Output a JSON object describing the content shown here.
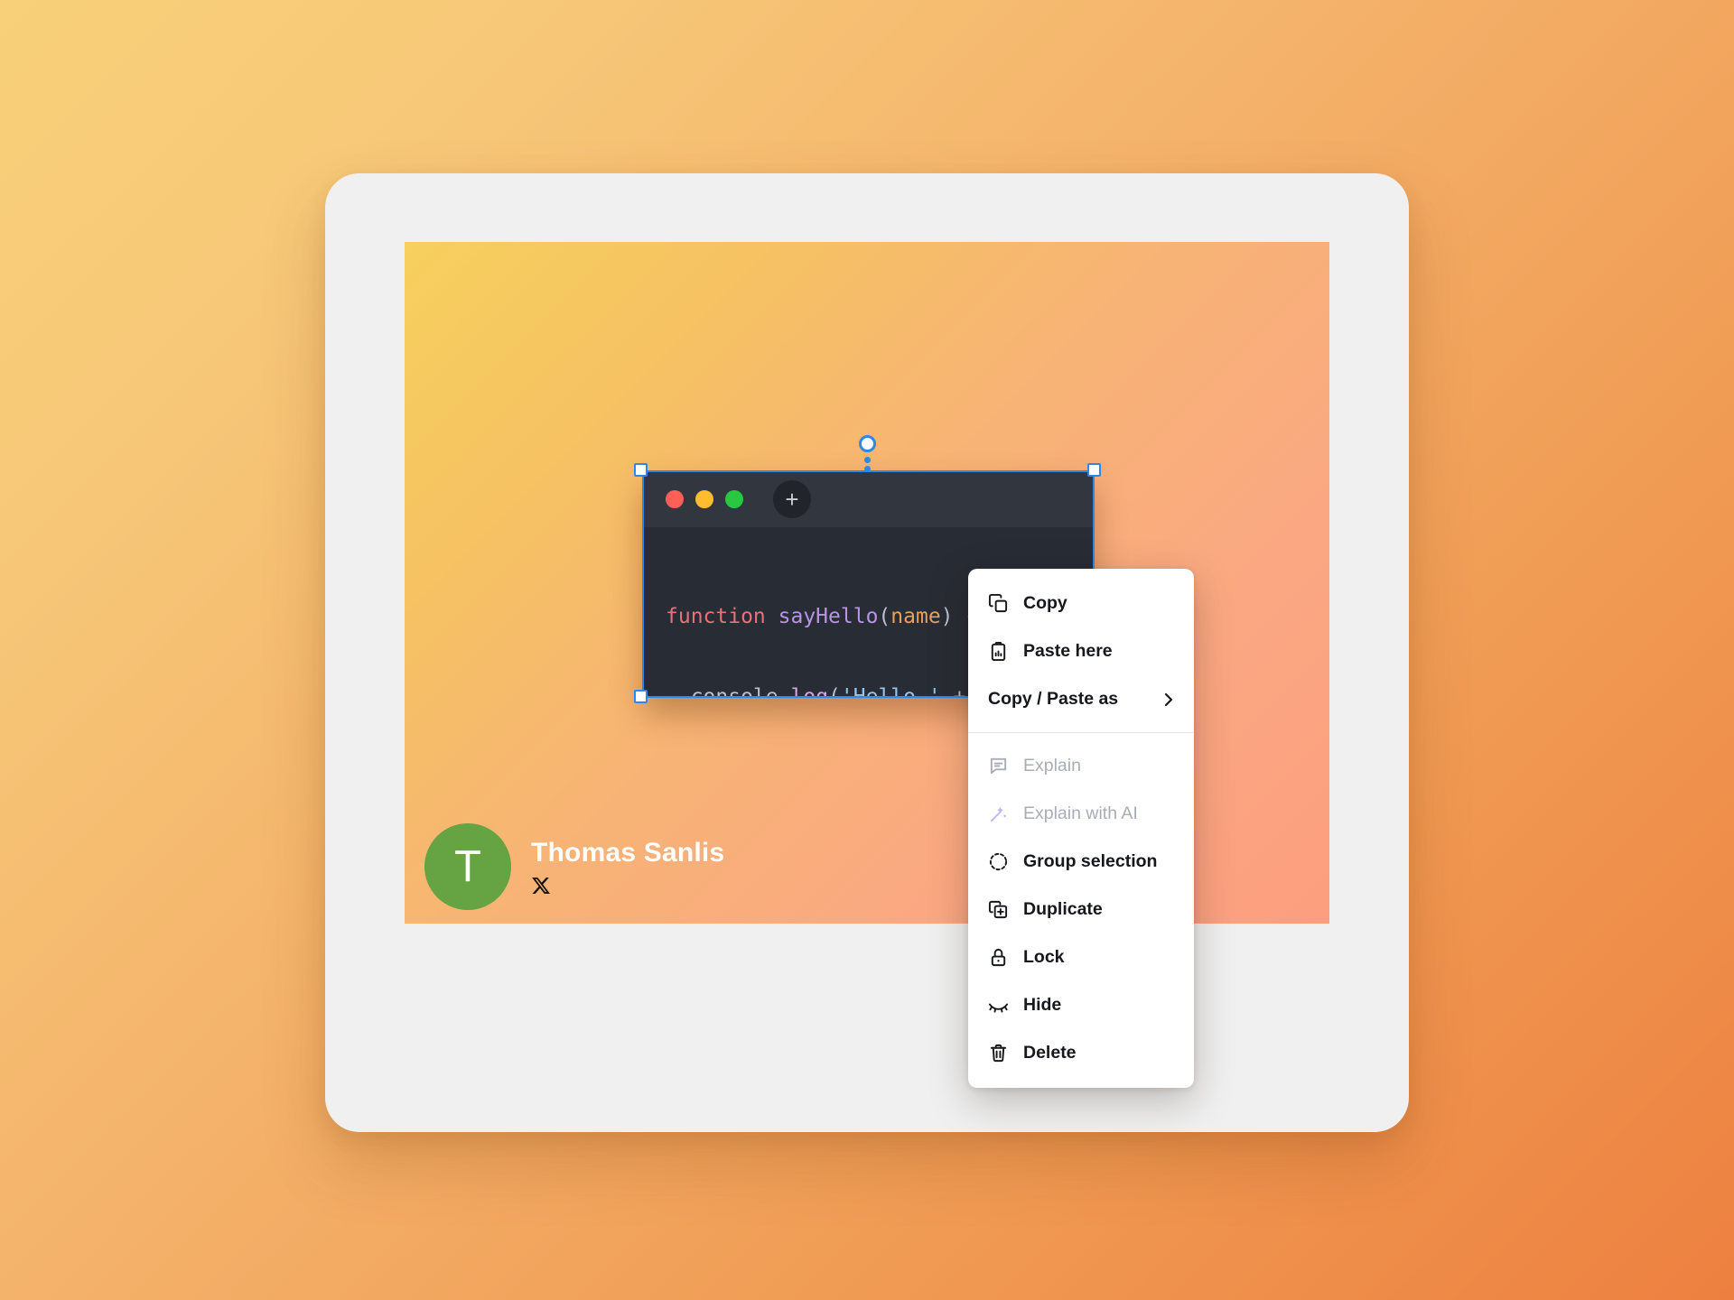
{
  "background": {
    "gradient_from": "#f8d079",
    "gradient_to": "#ed8040"
  },
  "card": {
    "frame_color": "#f0f0f0",
    "canvas_gradient_from": "#f7d05e",
    "canvas_gradient_to": "#fc9e7f"
  },
  "selection": {
    "accent_color": "#2f88e8",
    "handle_fill": "#ffffff",
    "rotation_handle_name": "rotation-handle"
  },
  "code_window": {
    "titlebar_color": "#32373f",
    "body_color": "#282c34",
    "traffic_lights": [
      {
        "name": "close",
        "color": "#ff5f57"
      },
      {
        "name": "minimize",
        "color": "#febc2e"
      },
      {
        "name": "maximize",
        "color": "#28c840"
      }
    ],
    "new_tab_label": "+",
    "code": {
      "line1": {
        "keyword": "function",
        "space1": " ",
        "fn_name": "sayHello",
        "open_paren": "(",
        "param": "name",
        "close": ") {"
      },
      "line2": {
        "indent": "  ",
        "object": "console",
        "dot": ".",
        "method": "log",
        "open_paren": "(",
        "string": "'Hello '",
        "rest": " + name);"
      },
      "line3": {
        "text": "}"
      }
    }
  },
  "author": {
    "avatar_initial": "T",
    "avatar_color": "#65a343",
    "name": "Thomas Sanlis",
    "social_icon": "x-twitter-icon"
  },
  "context_menu": {
    "groups": [
      {
        "items": [
          {
            "icon": "copy-icon",
            "label": "Copy",
            "disabled": false,
            "submenu": false
          },
          {
            "icon": "clipboard-paste-icon",
            "label": "Paste here",
            "disabled": false,
            "submenu": false
          },
          {
            "icon": "none",
            "label": "Copy / Paste as",
            "disabled": false,
            "submenu": true
          }
        ]
      },
      {
        "items": [
          {
            "icon": "speech-bubble-icon",
            "label": "Explain",
            "disabled": true,
            "submenu": false
          },
          {
            "icon": "magic-wand-icon",
            "label": "Explain with AI",
            "disabled": true,
            "submenu": false
          },
          {
            "icon": "dashed-circle-icon",
            "label": "Group selection",
            "disabled": false,
            "submenu": false
          },
          {
            "icon": "duplicate-icon",
            "label": "Duplicate",
            "disabled": false,
            "submenu": false
          },
          {
            "icon": "lock-icon",
            "label": "Lock",
            "disabled": false,
            "submenu": false
          },
          {
            "icon": "eye-closed-icon",
            "label": "Hide",
            "disabled": false,
            "submenu": false
          },
          {
            "icon": "trash-icon",
            "label": "Delete",
            "disabled": false,
            "submenu": false
          }
        ]
      }
    ],
    "ai_icon_color": "#c4b5fd",
    "disabled_text_color": "#a8adb6"
  }
}
